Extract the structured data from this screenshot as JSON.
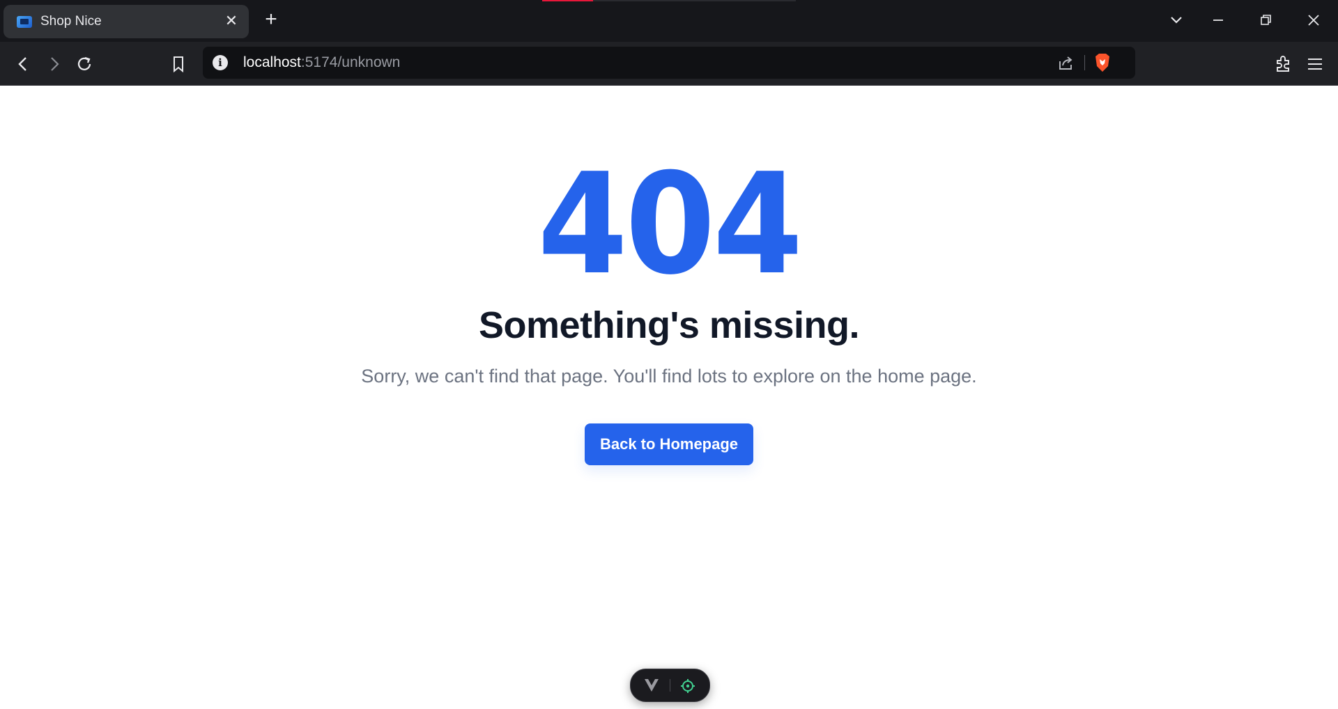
{
  "browser": {
    "tab": {
      "title": "Shop Nice",
      "close_label": "✕"
    },
    "new_tab_label": "+",
    "url": {
      "host": "localhost",
      "path": ":5174/unknown"
    },
    "info_label": "i",
    "colors": {
      "chrome_bg": "#16171b",
      "toolbar_bg": "#202125",
      "brave_orange": "#fb542b",
      "loading_red": "#e8173a"
    }
  },
  "page": {
    "error_code": "404",
    "heading": "Something's missing.",
    "subtitle": "Sorry, we can't find that page. You'll find lots to explore on the home page.",
    "button_label": "Back to Homepage",
    "colors": {
      "primary": "#2563eb",
      "heading": "#111827",
      "muted": "#6b7280"
    }
  },
  "devtools": {
    "logo_icon": "vue-v-icon",
    "inspect_icon": "crosshair-icon",
    "accent": "#42d392"
  }
}
